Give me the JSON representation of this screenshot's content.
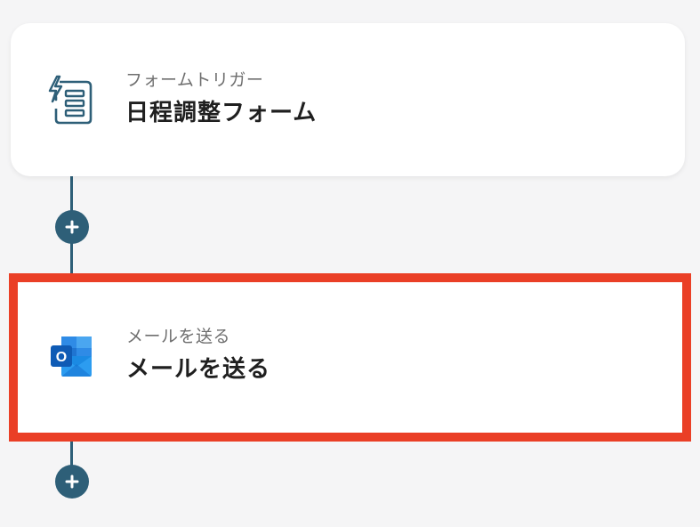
{
  "flow": {
    "steps": [
      {
        "subtitle": "フォームトリガー",
        "title": "日程調整フォーム",
        "icon": "form-trigger-icon"
      },
      {
        "subtitle": "メールを送る",
        "title": "メールを送る",
        "icon": "outlook-icon"
      }
    ],
    "add_step_icon": "plus-icon",
    "colors": {
      "connector": "#2e5f78",
      "highlight": "#ea3f26"
    }
  }
}
